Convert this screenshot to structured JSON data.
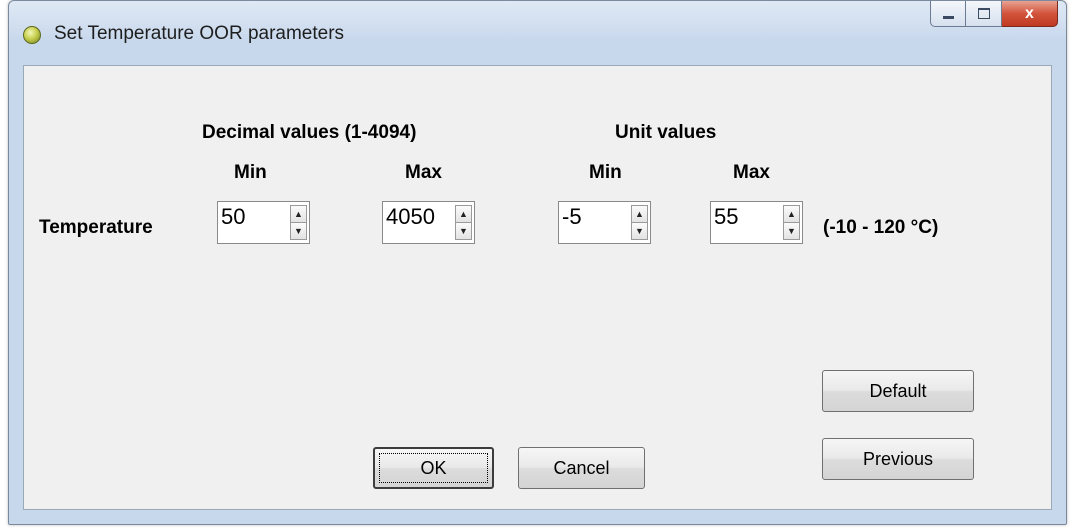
{
  "window": {
    "title": "Set Temperature OOR parameters",
    "controls": {
      "minimize_icon": "minimize-icon",
      "maximize_icon": "maximize-icon",
      "close_glyph": "x"
    }
  },
  "headers": {
    "decimal": "Decimal values (1-4094)",
    "unit": "Unit values",
    "min_1": "Min",
    "max_1": "Max",
    "min_2": "Min",
    "max_2": "Max"
  },
  "row": {
    "label": "Temperature",
    "decimal_min": "50",
    "decimal_max": "4050",
    "unit_min": "-5",
    "unit_max": "55",
    "range_note": "(-10  -  120 °C)"
  },
  "spin_arrows": {
    "up": "▲",
    "down": "▼"
  },
  "buttons": {
    "ok": "OK",
    "cancel": "Cancel",
    "default": "Default",
    "previous": "Previous"
  }
}
